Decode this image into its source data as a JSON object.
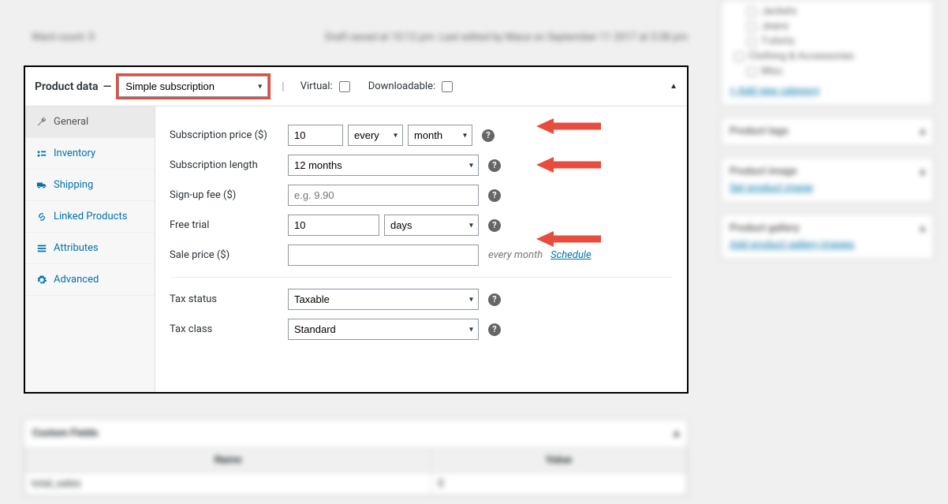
{
  "header": {
    "title": "Product data",
    "title_sep": " — ",
    "type_selected": "Simple subscription",
    "virtual_label": "Virtual:",
    "downloadable_label": "Downloadable:"
  },
  "tabs": [
    {
      "label": "General",
      "icon": "wrench",
      "active": true
    },
    {
      "label": "Inventory",
      "icon": "inventory",
      "active": false
    },
    {
      "label": "Shipping",
      "icon": "truck",
      "active": false
    },
    {
      "label": "Linked Products",
      "icon": "link",
      "active": false
    },
    {
      "label": "Attributes",
      "icon": "attrs",
      "active": false
    },
    {
      "label": "Advanced",
      "icon": "gear",
      "active": false
    }
  ],
  "fields": {
    "sub_price": {
      "label": "Subscription price ($)",
      "value": "10",
      "every": "every",
      "period": "month"
    },
    "sub_length": {
      "label": "Subscription length",
      "value": "12 months"
    },
    "signup": {
      "label": "Sign-up fee ($)",
      "placeholder": "e.g. 9.90"
    },
    "trial": {
      "label": "Free trial",
      "value": "10",
      "unit": "days"
    },
    "sale": {
      "label": "Sale price ($)",
      "value": "",
      "hint": "every month",
      "schedule": "Schedule"
    },
    "tax_status": {
      "label": "Tax status",
      "value": "Taxable"
    },
    "tax_class": {
      "label": "Tax class",
      "value": "Standard"
    }
  },
  "bg": {
    "top_left": "Ward count: 0",
    "top_right": "Draft saved at 10:12 pm. Last edited by Mace on September 11 2017 at 3:38 pm",
    "side_cats": [
      "Jackets",
      "Jeans",
      "T-shirts",
      "Clothing & Accessories",
      "Misc"
    ],
    "add_cat": "+ Add new category",
    "tags_h": "Product tags",
    "image_h": "Product image",
    "image_link": "Set product image",
    "gallery_h": "Product gallery",
    "gallery_link": "Add product gallery images",
    "custom_h": "Custom Fields",
    "col_name": "Name",
    "col_value": "Value",
    "row_name": "total_sales"
  }
}
